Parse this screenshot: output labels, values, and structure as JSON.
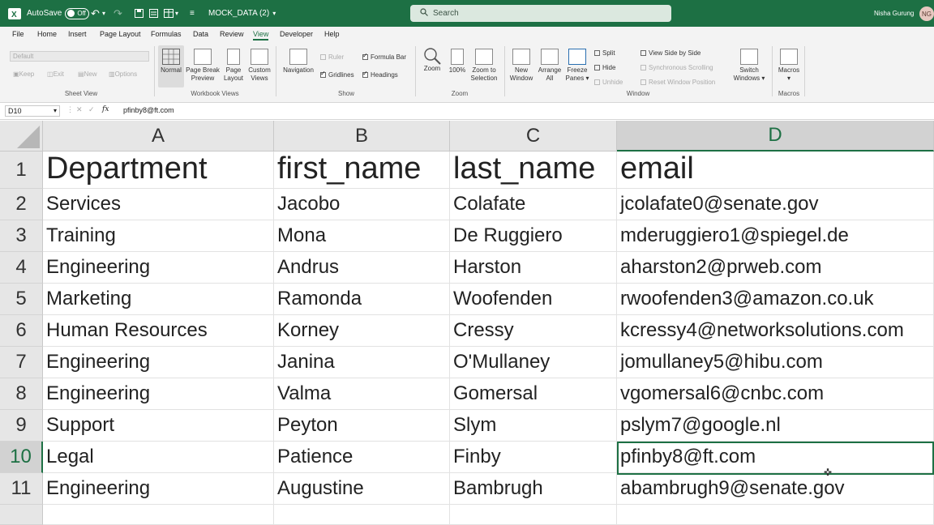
{
  "titlebar": {
    "autosave_label": "AutoSave",
    "autosave_state": "Off",
    "filename": "MOCK_DATA (2)",
    "search_placeholder": "Search",
    "user_name": "Nisha Gurung",
    "user_initials": "NG"
  },
  "tabs": [
    "File",
    "Home",
    "Insert",
    "Page Layout",
    "Formulas",
    "Data",
    "Review",
    "View",
    "Developer",
    "Help"
  ],
  "active_tab": "View",
  "ribbon": {
    "sheet_view": {
      "dropdown": "Default",
      "keep": "Keep",
      "exit": "Exit",
      "new": "New",
      "options": "Options",
      "label": "Sheet View"
    },
    "workbook_views": {
      "normal": "Normal",
      "page_break_1": "Page Break",
      "page_break_2": "Preview",
      "page_layout_1": "Page",
      "page_layout_2": "Layout",
      "custom_1": "Custom",
      "custom_2": "Views",
      "label": "Workbook Views"
    },
    "show": {
      "navigation": "Navigation",
      "ruler": "Ruler",
      "gridlines": "Gridlines",
      "formula_bar": "Formula Bar",
      "headings": "Headings",
      "label": "Show"
    },
    "zoom": {
      "zoom": "Zoom",
      "hundred": "100%",
      "zoom_sel_1": "Zoom to",
      "zoom_sel_2": "Selection",
      "label": "Zoom"
    },
    "window": {
      "new_1": "New",
      "new_2": "Window",
      "arrange_1": "Arrange",
      "arrange_2": "All",
      "freeze_1": "Freeze",
      "freeze_2": "Panes",
      "split": "Split",
      "hide": "Hide",
      "unhide": "Unhide",
      "side_by_side": "View Side by Side",
      "sync_scroll": "Synchronous Scrolling",
      "reset_pos": "Reset Window Position",
      "switch_1": "Switch",
      "switch_2": "Windows",
      "label": "Window"
    },
    "macros": {
      "macros": "Macros",
      "label": "Macros"
    }
  },
  "formula_bar": {
    "name_box": "D10",
    "fx": "fx",
    "value": "pfinby8@ft.com"
  },
  "columns": [
    "A",
    "B",
    "C",
    "D"
  ],
  "rows": [
    {
      "num": "1",
      "cells": [
        "Department",
        "first_name",
        "last_name",
        "email"
      ]
    },
    {
      "num": "2",
      "cells": [
        "Services",
        "Jacobo",
        "Colafate",
        "jcolafate0@senate.gov"
      ]
    },
    {
      "num": "3",
      "cells": [
        "Training",
        "Mona",
        "De Ruggiero",
        "mderuggiero1@spiegel.de"
      ]
    },
    {
      "num": "4",
      "cells": [
        "Engineering",
        "Andrus",
        "Harston",
        "aharston2@prweb.com"
      ]
    },
    {
      "num": "5",
      "cells": [
        "Marketing",
        "Ramonda",
        "Woofenden",
        "rwoofenden3@amazon.co.uk"
      ]
    },
    {
      "num": "6",
      "cells": [
        "Human Resources",
        "Korney",
        "Cressy",
        "kcressy4@networksolutions.com"
      ]
    },
    {
      "num": "7",
      "cells": [
        "Engineering",
        "Janina",
        "O'Mullaney",
        "jomullaney5@hibu.com"
      ]
    },
    {
      "num": "8",
      "cells": [
        "Engineering",
        "Valma",
        "Gomersal",
        "vgomersal6@cnbc.com"
      ]
    },
    {
      "num": "9",
      "cells": [
        "Support",
        "Peyton",
        "Slym",
        "pslym7@google.nl"
      ]
    },
    {
      "num": "10",
      "cells": [
        "Legal",
        "Patience",
        "Finby",
        "pfinby8@ft.com"
      ]
    },
    {
      "num": "11",
      "cells": [
        "Engineering",
        "Augustine",
        "Bambrugh",
        "abambrugh9@senate.gov"
      ]
    }
  ],
  "active_cell": "D10",
  "colors": {
    "accent": "#1d7044"
  }
}
